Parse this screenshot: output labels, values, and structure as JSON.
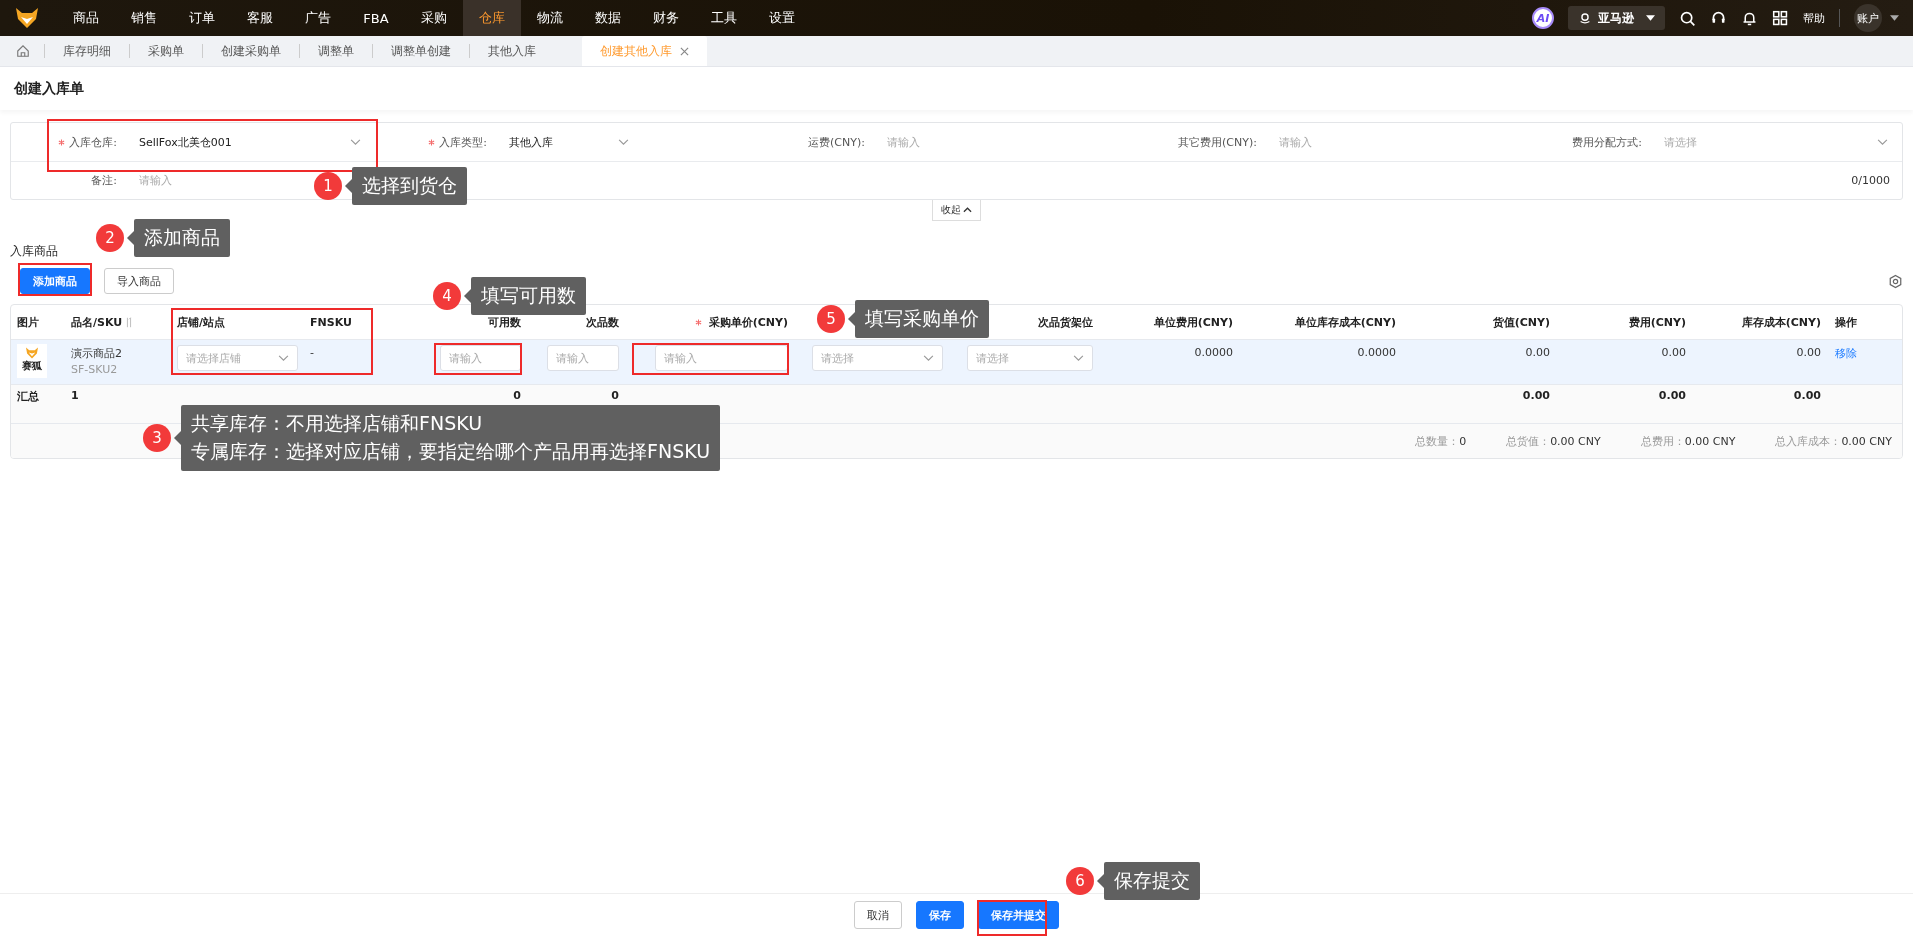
{
  "nav": {
    "items": [
      {
        "label": "商品",
        "selected": false
      },
      {
        "label": "销售",
        "selected": false
      },
      {
        "label": "订单",
        "selected": false
      },
      {
        "label": "客服",
        "selected": false
      },
      {
        "label": "广告",
        "selected": false
      },
      {
        "label": "FBA",
        "selected": false
      },
      {
        "label": "采购",
        "selected": false
      },
      {
        "label": "仓库",
        "selected": true
      },
      {
        "label": "物流",
        "selected": false
      },
      {
        "label": "数据",
        "selected": false
      },
      {
        "label": "财务",
        "selected": false
      },
      {
        "label": "工具",
        "selected": false
      },
      {
        "label": "设置",
        "selected": false
      }
    ],
    "ai_badge": "AI",
    "platform": "亚马逊",
    "help": "帮助",
    "account": "账户"
  },
  "tabs": [
    {
      "label": "库存明细",
      "selected": false
    },
    {
      "label": "采购单",
      "selected": false
    },
    {
      "label": "创建采购单",
      "selected": false
    },
    {
      "label": "调整单",
      "selected": false
    },
    {
      "label": "调整单创建",
      "selected": false
    },
    {
      "label": "其他入库",
      "selected": false
    },
    {
      "label": "创建其他入库",
      "selected": true
    }
  ],
  "page_title": "创建入库单",
  "form": {
    "fields": [
      {
        "label": "入库仓库:",
        "required": true,
        "kind": "select",
        "value": "SellFox北美仓001"
      },
      {
        "label": "入库类型:",
        "required": true,
        "kind": "select",
        "value": "其他入库"
      },
      {
        "label": "运费(CNY):",
        "required": false,
        "kind": "input",
        "placeholder": "请输入"
      },
      {
        "label": "其它费用(CNY):",
        "required": false,
        "kind": "input",
        "placeholder": "请输入"
      },
      {
        "label": "费用分配方式:",
        "required": false,
        "kind": "select",
        "placeholder": "请选择"
      }
    ],
    "remark": {
      "label": "备注:",
      "placeholder": "请输入",
      "counter": "0/1000"
    },
    "collapse": "收起"
  },
  "section_title": "入库商品",
  "toolbar_buttons": [
    {
      "label": "添加商品",
      "kind": "primary"
    },
    {
      "label": "导入商品",
      "kind": "default"
    }
  ],
  "table": {
    "columns": [
      {
        "label": "图片"
      },
      {
        "label": "品名/SKU",
        "sortable": true
      },
      {
        "label": "店铺/站点"
      },
      {
        "label": "FNSKU"
      },
      {
        "label": "可用数"
      },
      {
        "label": "次品数"
      },
      {
        "label": "采购单价(CNY)",
        "required": true
      },
      {},
      {
        "label": "次品货架位"
      },
      {
        "label": "单位费用(CNY)"
      },
      {
        "label": "单位库存成本(CNY)"
      },
      {
        "label": "货值(CNY)"
      },
      {
        "label": "费用(CNY)"
      },
      {
        "label": "库存成本(CNY)"
      },
      {
        "label": "操作"
      }
    ],
    "rows": [
      [
        {
          "kind": "image",
          "caption": "赛狐"
        },
        {
          "kind": "name_sku",
          "name": "演示商品2",
          "sku": "SF-SKU2"
        },
        {
          "kind": "select",
          "placeholder": "请选择店铺"
        },
        {
          "kind": "text",
          "text": "-"
        },
        {
          "kind": "input",
          "placeholder": "请输入"
        },
        {
          "kind": "input",
          "placeholder": "请输入"
        },
        {
          "kind": "input",
          "placeholder": "请输入"
        },
        {
          "kind": "select",
          "placeholder": "请选择"
        },
        {
          "kind": "select",
          "placeholder": "请选择"
        },
        {
          "kind": "text",
          "text": "0.0000"
        },
        {
          "kind": "text",
          "text": "0.0000"
        },
        {
          "kind": "text",
          "text": "0.00"
        },
        {
          "kind": "text",
          "text": "0.00"
        },
        {
          "kind": "text",
          "text": "0.00"
        },
        {
          "kind": "link",
          "text": "移除"
        }
      ]
    ],
    "summary": {
      "label": "汇总",
      "count": "1",
      "available": "0",
      "defective": "0",
      "goods_value": "0.00",
      "fee": "0.00",
      "stock_cost": "0.00"
    },
    "totals": [
      {
        "label": "总数量：",
        "value": "0"
      },
      {
        "label": "总货值：",
        "value": "0.00 CNY"
      },
      {
        "label": "总费用：",
        "value": "0.00 CNY"
      },
      {
        "label": "总入库成本：",
        "value": "0.00 CNY"
      }
    ]
  },
  "callouts": [
    {
      "number": "1",
      "lines": [
        "选择到货仓"
      ]
    },
    {
      "number": "2",
      "lines": [
        "添加商品"
      ]
    },
    {
      "number": "3",
      "lines": [
        "共享库存：不用选择店铺和FNSKU",
        "专属库存：选择对应店铺，要指定给哪个产品用再选择FNSKU"
      ]
    },
    {
      "number": "4",
      "lines": [
        "填写可用数"
      ]
    },
    {
      "number": "5",
      "lines": [
        "填写采购单价"
      ]
    },
    {
      "number": "6",
      "lines": [
        "保存提交"
      ]
    }
  ],
  "footer_buttons": [
    {
      "label": "取消",
      "kind": "default"
    },
    {
      "label": "保存",
      "kind": "primary"
    },
    {
      "label": "保存并提交",
      "kind": "primary"
    }
  ]
}
